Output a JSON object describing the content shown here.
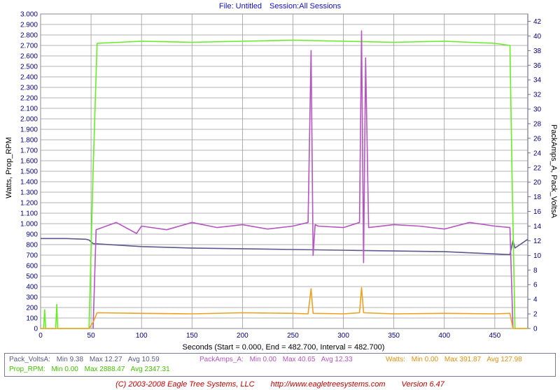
{
  "header": {
    "file_label": "File: Untitled",
    "session_label": "Session:All Sessions"
  },
  "chart_data": {
    "type": "line",
    "title": "",
    "xlabel": "Seconds (Start = 0.000,  End = 482.700,  Interval = 482.700)",
    "ylabel_left": "Watts, Prop_RPM",
    "ylabel_right": "PackAmps_A, Pack_VoltsA",
    "xlim": [
      0,
      482.7
    ],
    "ylim_left": [
      0,
      3000
    ],
    "ylim_right": [
      0,
      43
    ],
    "x_ticks": [
      "0",
      "50",
      "100",
      "150",
      "200",
      "250",
      "300",
      "350",
      "400",
      "450"
    ],
    "y_left_ticks": [
      "0",
      "100",
      "200",
      "300",
      "400",
      "500",
      "600",
      "700",
      "800",
      "900",
      "1.000",
      "1.100",
      "1.200",
      "1.300",
      "1.400",
      "1.500",
      "1.600",
      "1.700",
      "1.800",
      "1.900",
      "2.000",
      "2.100",
      "2.200",
      "2.300",
      "2.400",
      "2.500",
      "2.600",
      "2.700",
      "2.800",
      "2.900",
      "3.000"
    ],
    "y_right_ticks": [
      "0",
      "2",
      "4",
      "6",
      "8",
      "10",
      "12",
      "14",
      "16",
      "18",
      "20",
      "22",
      "24",
      "26",
      "28",
      "30",
      "32",
      "34",
      "36",
      "38",
      "40",
      "42"
    ],
    "grid": true,
    "series": [
      {
        "name": "Pack_VoltsA",
        "axis": "right",
        "color": "#5a5a8c",
        "x": [
          0,
          25,
          45,
          48,
          52,
          100,
          150,
          200,
          250,
          300,
          350,
          400,
          450,
          465,
          468,
          470,
          482.7
        ],
        "y": [
          12.3,
          12.3,
          12.2,
          12.1,
          11.6,
          11.2,
          11.0,
          10.9,
          10.8,
          10.7,
          10.6,
          10.5,
          10.2,
          10.1,
          12.0,
          11.0,
          12.2
        ]
      },
      {
        "name": "Prop_RPM",
        "axis": "left",
        "color": "#66ee22",
        "x": [
          0,
          3,
          4,
          5,
          15,
          16,
          17,
          48,
          52,
          56,
          100,
          150,
          200,
          250,
          300,
          350,
          400,
          450,
          465,
          467,
          470,
          482.7
        ],
        "y": [
          0,
          0,
          180,
          0,
          0,
          230,
          0,
          0,
          1500,
          2720,
          2740,
          2730,
          2740,
          2750,
          2740,
          2730,
          2740,
          2720,
          2700,
          1500,
          0,
          0
        ]
      },
      {
        "name": "PackAmps_A",
        "axis": "right",
        "color": "#b455c0",
        "x": [
          52,
          55,
          75,
          95,
          100,
          125,
          150,
          175,
          200,
          225,
          250,
          265,
          268,
          270,
          272,
          275,
          300,
          316,
          318,
          320,
          322,
          325,
          350,
          375,
          400,
          425,
          450,
          465,
          468
        ],
        "y": [
          0,
          13.5,
          14.5,
          13.0,
          14.0,
          13.5,
          14.5,
          13.8,
          14.2,
          13.6,
          14.0,
          14.5,
          38,
          10,
          14.2,
          14.0,
          13.8,
          14.5,
          40.7,
          9,
          37,
          13.8,
          14.2,
          14.0,
          13.6,
          14.5,
          14.0,
          13.8,
          0
        ]
      },
      {
        "name": "Watts",
        "axis": "left",
        "color": "#f0a020",
        "x": [
          0,
          48,
          52,
          56,
          100,
          150,
          200,
          250,
          265,
          268,
          270,
          300,
          316,
          318,
          320,
          350,
          400,
          450,
          465,
          468,
          482.7
        ],
        "y": [
          0,
          0,
          60,
          150,
          145,
          140,
          150,
          145,
          140,
          380,
          145,
          140,
          150,
          390,
          150,
          140,
          145,
          140,
          145,
          0,
          0
        ]
      }
    ]
  },
  "stats": {
    "volts": {
      "name": "Pack_VoltsA:",
      "min": "Min 9.38",
      "max": "Max 12.27",
      "avg": "Avg 10.59"
    },
    "rpm": {
      "name": "Prop_RPM:",
      "min": "Min 0.00",
      "max": "Max 2888.47",
      "avg": "Avg 2347.31"
    },
    "amps": {
      "name": "PackAmps_A:",
      "min": "Min 0.00",
      "max": "Max 40.65",
      "avg": "Avg 12.33"
    },
    "watts": {
      "name": "Watts:",
      "min": "Min 0.00",
      "max": "Max 391.87",
      "avg": "Avg 127.98"
    }
  },
  "footer": {
    "copyright": "(C) 2003-2008 Eagle Tree Systems, LLC",
    "url": "http://www.eagletreesystems.com",
    "version": "Version 6.47"
  },
  "colors": {
    "volts": "#5a5a8c",
    "rpm": "#66ee22",
    "amps": "#b455c0",
    "watts": "#f0a020",
    "grid": "#9a9a9a"
  }
}
